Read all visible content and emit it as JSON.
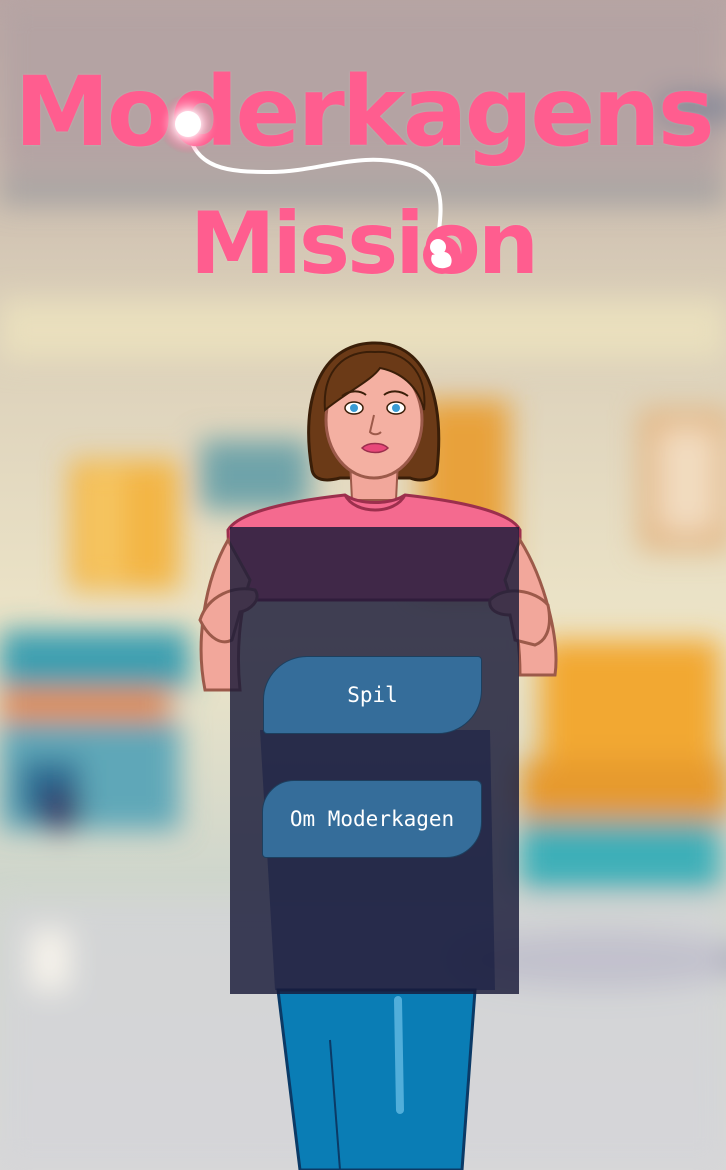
{
  "title": {
    "line1": "Moderkagens",
    "line2": "Mission"
  },
  "menu": {
    "play_label": "Spil",
    "about_label": "Om Moderkagen"
  },
  "colors": {
    "title_pink": "#ff5d8f",
    "button_blue": "#356d9a",
    "panel_navy": "#181a38",
    "shirt_pink": "#f46a8f",
    "jeans_blue": "#0a7db5"
  },
  "icons": {
    "o_letter": "glowing-orb-icon",
    "o_letter2": "fetus-icon"
  }
}
